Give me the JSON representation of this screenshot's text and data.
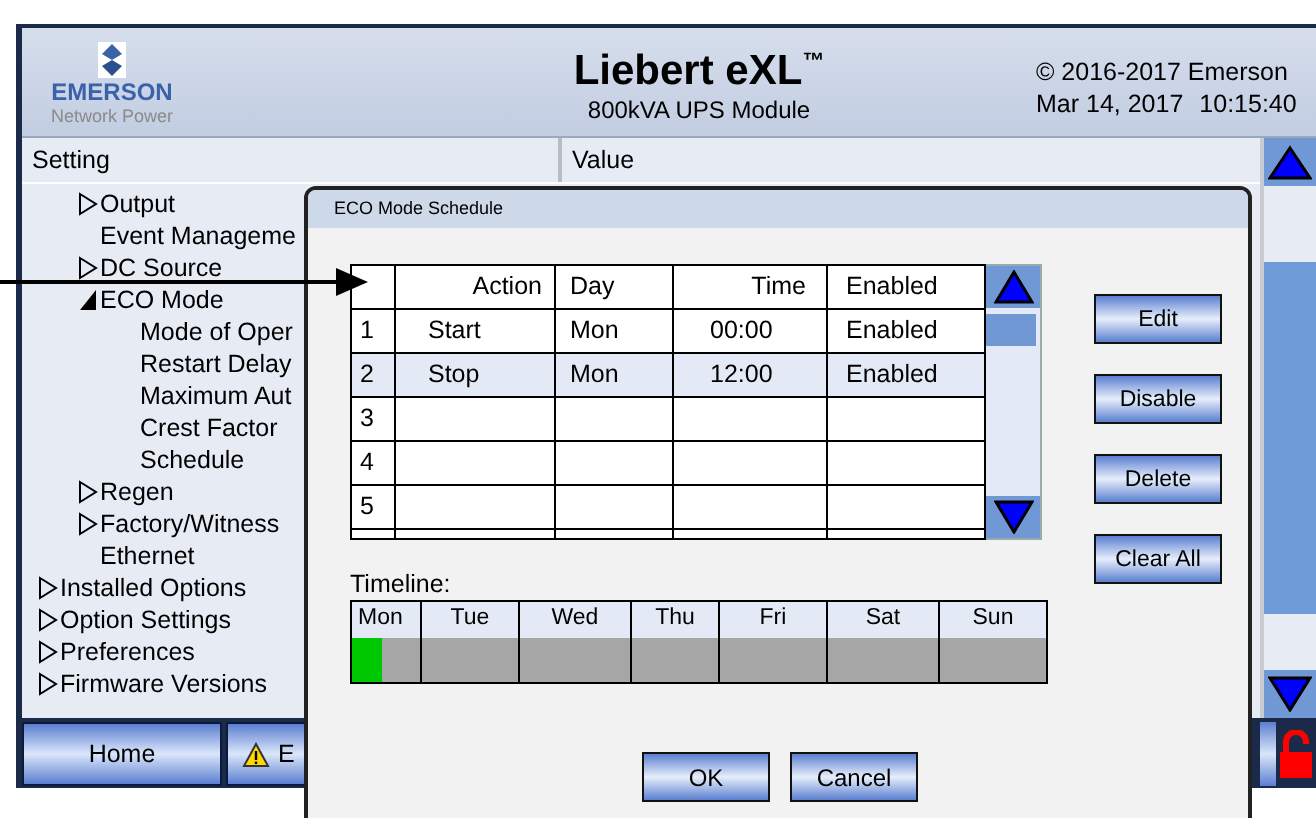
{
  "header": {
    "logo_text": "EMERSON",
    "logo_subtext": "Network Power",
    "title": "Liebert eXL$^{™}$",
    "subtitle": "800kVA UPS Module",
    "copyright": "© 2016-2017 Emerson",
    "date": "Mar 14, 2017",
    "time": "10:15:40"
  },
  "columns": [
    "Setting",
    "Value"
  ],
  "tree": [
    {
      "kind": "continued",
      "children": [
        {
          "kind": "group",
          "label": "Output",
          "expanded": false
        },
        {
          "kind": "leaf",
          "label": "Event Manageme"
        },
        {
          "kind": "group",
          "label": "DC Source",
          "expanded": false
        },
        {
          "kind": "group",
          "label": "ECO Mode",
          "expanded": true,
          "children": [
            {
              "kind": "leaf",
              "label": "Mode of Oper"
            },
            {
              "kind": "leaf",
              "label": "Restart Delay"
            },
            {
              "kind": "leaf",
              "label": "Maximum Aut"
            },
            {
              "kind": "leaf",
              "label": "Crest Factor"
            },
            {
              "kind": "leaf",
              "label": "Schedule"
            }
          ]
        },
        {
          "kind": "group",
          "label": "Regen",
          "expanded": false
        },
        {
          "kind": "group",
          "label": "Factory/Witness",
          "expanded": false
        },
        {
          "kind": "leaf",
          "label": "Ethernet"
        }
      ]
    },
    {
      "kind": "group",
      "label": "Installed Options",
      "expanded": false
    },
    {
      "kind": "group",
      "label": "Option Settings",
      "expanded": false
    },
    {
      "kind": "group",
      "label": "Preferences",
      "expanded": false
    },
    {
      "kind": "group",
      "label": "Firmware Versions",
      "expanded": false
    }
  ],
  "bottom_bar": [
    {
      "kind": "home",
      "label": "Home"
    },
    {
      "kind": "alarm",
      "label": "E"
    }
  ],
  "dialog": {
    "title": "ECO Mode Schedule",
    "columns": [
      "Action",
      "Day",
      "Time",
      "Enabled"
    ],
    "rows": [
      {
        "number": "1",
        "action": "Start",
        "day": "Mon",
        "time": "00:00",
        "enabled": "Enabled",
        "selected": false
      },
      {
        "number": "2",
        "action": "Stop",
        "day": "Mon",
        "time": "12:00",
        "enabled": "Enabled",
        "selected": true
      },
      {
        "number": "3",
        "selected": false
      },
      {
        "number": "4",
        "selected": false
      },
      {
        "number": "5",
        "selected": false
      }
    ],
    "side_buttons": [
      "Edit",
      "Disable",
      "Delete",
      "Clear All"
    ],
    "timeline_label": "Timeline:",
    "days": [
      "Mon",
      "Tue",
      "Wed",
      "Thu",
      "Fri",
      "Sat",
      "Sun"
    ],
    "timeline": {
      "level": 0.043
    },
    "buttons": [
      "OK",
      "Cancel"
    ]
  }
}
